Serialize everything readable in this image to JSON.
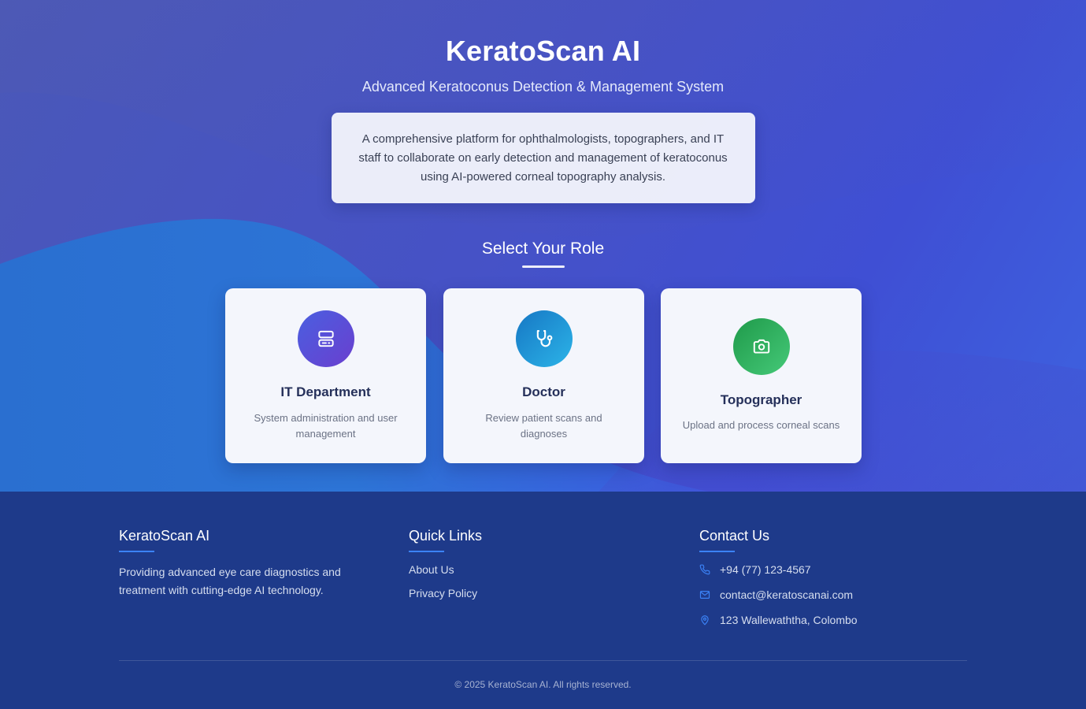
{
  "header": {
    "title": "KeratoScan AI",
    "subtitle": "Advanced Keratoconus Detection & Management System",
    "description": "A comprehensive platform for ophthalmologists, topographers, and IT staff to collaborate on early detection and management of keratoconus using AI-powered corneal topography analysis."
  },
  "roles": {
    "heading": "Select Your Role",
    "items": [
      {
        "title": "IT Department",
        "description": "System administration and user management",
        "icon": "server-icon",
        "color": "#5b48d8"
      },
      {
        "title": "Doctor",
        "description": "Review patient scans and diagnoses",
        "icon": "stethoscope-icon",
        "color": "#1f9ad6"
      },
      {
        "title": "Topographer",
        "description": "Upload and process corneal scans",
        "icon": "camera-icon",
        "color": "#2eb35f"
      }
    ]
  },
  "footer": {
    "brand": {
      "title": "KeratoScan AI",
      "text": "Providing advanced eye care diagnostics and treatment with cutting-edge AI technology."
    },
    "quick_links": {
      "title": "Quick Links",
      "links": [
        "About Us",
        "Privacy Policy"
      ]
    },
    "contact": {
      "title": "Contact Us",
      "phone": "+94 (77) 123-4567",
      "email": "contact@keratoscanai.com",
      "address": "123 Wallewaththa, Colombo"
    },
    "copyright": "© 2025 KeratoScan AI. All rights reserved."
  },
  "colors": {
    "footer_bg": "#1e3a8a",
    "accent": "#3b82f6",
    "hero_primary": "#4652c6"
  }
}
